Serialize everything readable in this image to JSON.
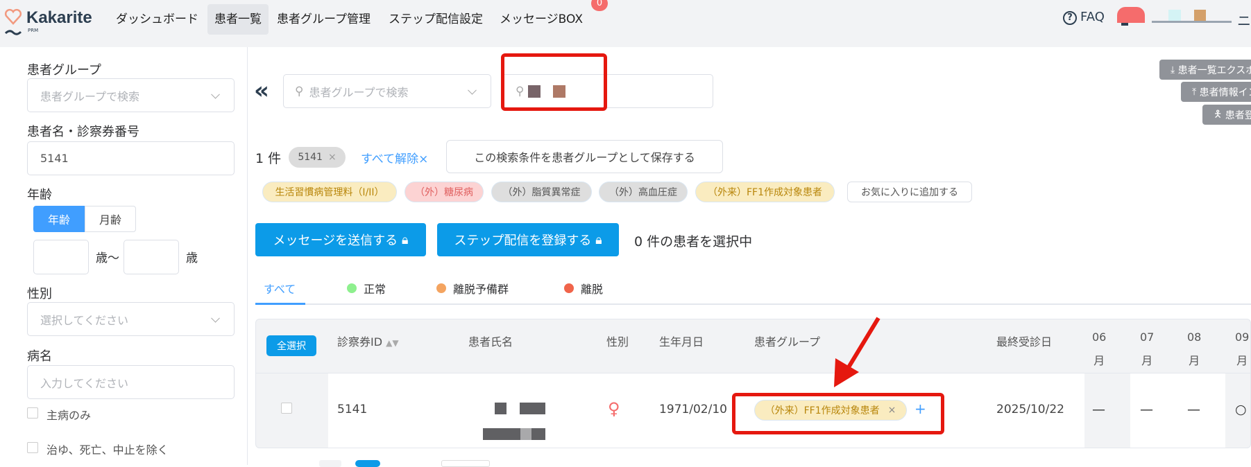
{
  "header": {
    "logo": "Kakarite",
    "logo_sub": "PRM",
    "nav": [
      "ダッシュボード",
      "患者一覧",
      "患者グループ管理",
      "ステップ配信設定",
      "メッセージBOX"
    ],
    "message_badge": "0",
    "faq": "FAQ",
    "user_tail": "ニ"
  },
  "sidebar": {
    "group_label": "患者グループ",
    "group_placeholder": "患者グループで検索",
    "name_label": "患者名・診察券番号",
    "name_value": "5141",
    "age_label": "年齢",
    "age_toggle": [
      "年齢",
      "月齢"
    ],
    "age_unit_from": "歳～",
    "age_unit_to": "歳",
    "sex_label": "性別",
    "sex_placeholder": "選択してください",
    "disease_label": "病名",
    "disease_placeholder": "入力してください",
    "main_only": "主病のみ",
    "exclude": "治ゆ、死亡、中止を除く"
  },
  "main": {
    "collapse": "«",
    "group_search_placeholder": "患者グループで検索",
    "side_buttons": [
      "患者一覧エクスポート",
      "患者情報インポート",
      "患者登録"
    ],
    "result_count": "1 件",
    "filter_chip": "5141",
    "clear_all": "すべて解除×",
    "save_condition": "この検索条件を患者グループとして保存する",
    "group_tags": [
      {
        "label": "生活習慣病管理料（I/II）",
        "bg": "#faecc0",
        "color": "#b8860b"
      },
      {
        "label": "（外）糖尿病",
        "bg": "#fcd3d3",
        "color": "#e06060"
      },
      {
        "label": "（外）脂質異常症",
        "bg": "#dedede",
        "color": "#555555"
      },
      {
        "label": "（外）高血圧症",
        "bg": "#dedede",
        "color": "#555555"
      },
      {
        "label": "（外来）FF1作成対象患者",
        "bg": "#faecc0",
        "color": "#b8860b"
      },
      {
        "label": "お気に入りに追加する",
        "bg": "#ffffff",
        "color": "#555555"
      }
    ],
    "send_message": "メッセージを送信する",
    "register_step": "ステップ配信を登録する",
    "selected_count": "0 件の患者を選択中",
    "tabs": [
      {
        "label": "すべて"
      },
      {
        "label": "正常",
        "color": "#8ef08e"
      },
      {
        "label": "離脱予備群",
        "color": "#f4a460"
      },
      {
        "label": "離脱",
        "color": "#f0644a"
      }
    ]
  },
  "table": {
    "select_all": "全選択",
    "headers": [
      "診察券ID",
      "患者氏名",
      "性別",
      "生年月日",
      "患者グループ",
      "最終受診日"
    ],
    "months": [
      [
        "06",
        "月"
      ],
      [
        "07",
        "月"
      ],
      [
        "08",
        "月"
      ],
      [
        "09",
        "月"
      ]
    ],
    "row": {
      "id": "5141",
      "sex": "♀",
      "birth": "1971/02/10",
      "group": "（外来）FF1作成対象患者",
      "group_remove": "×",
      "group_add": "+",
      "last_visit": "2025/10/22",
      "months": [
        "—",
        "—",
        "—",
        "○"
      ]
    }
  }
}
